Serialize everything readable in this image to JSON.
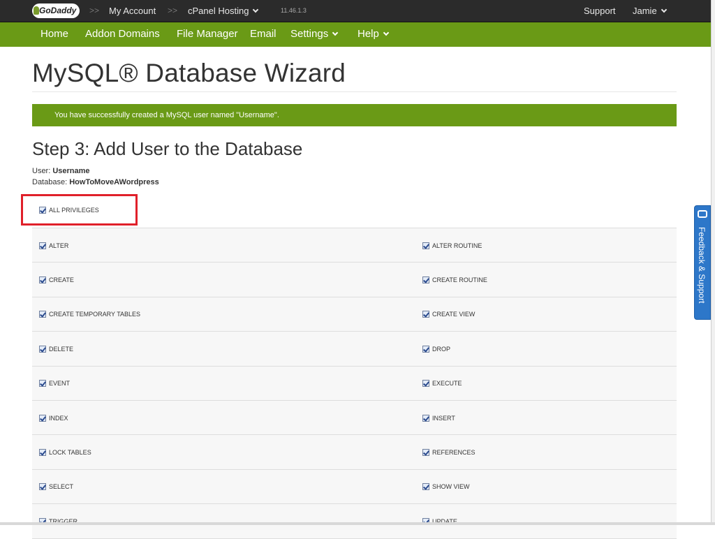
{
  "topbar": {
    "logo": "GoDaddy",
    "breadcrumb_sep": ">>",
    "my_account": "My Account",
    "cpanel": "cPanel Hosting",
    "version": "11.46.1.3",
    "support": "Support",
    "user": "Jamie"
  },
  "nav": {
    "items": [
      "Home",
      "Addon Domains",
      "File Manager",
      "Email",
      "Settings",
      "Help"
    ]
  },
  "page": {
    "title": "MySQL® Database Wizard",
    "alert": "You have successfully created a MySQL user named \"Username\".",
    "step_title": "Step 3: Add User to the Database",
    "user_label": "User:",
    "user_value": "Username",
    "db_label": "Database:",
    "db_value": "HowToMoveAWordpress",
    "all_privileges": "ALL PRIVILEGES"
  },
  "privileges": [
    [
      "ALTER",
      "ALTER ROUTINE"
    ],
    [
      "CREATE",
      "CREATE ROUTINE"
    ],
    [
      "CREATE TEMPORARY TABLES",
      "CREATE VIEW"
    ],
    [
      "DELETE",
      "DROP"
    ],
    [
      "EVENT",
      "EXECUTE"
    ],
    [
      "INDEX",
      "INSERT"
    ],
    [
      "LOCK TABLES",
      "REFERENCES"
    ],
    [
      "SELECT",
      "SHOW VIEW"
    ],
    [
      "TRIGGER",
      "UPDATE"
    ]
  ],
  "feedback": "Feedback & Support",
  "colors": {
    "nav_green": "#6a9a16",
    "topbar": "#2b2b2b",
    "highlight_red": "#e0202a",
    "feedback_blue": "#2d77c9"
  }
}
